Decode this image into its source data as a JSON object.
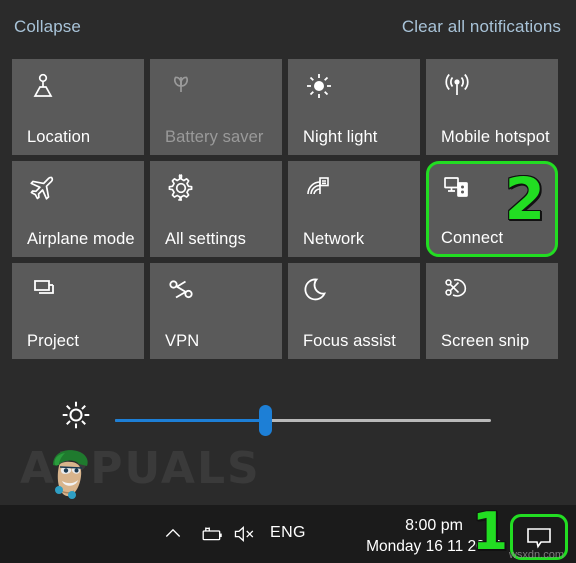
{
  "action_center": {
    "collapse_label": "Collapse",
    "clear_all_label": "Clear all notifications",
    "tiles": [
      {
        "label": "Location",
        "icon": "location-icon",
        "state": "on"
      },
      {
        "label": "Battery saver",
        "icon": "battery-saver-icon",
        "state": "disabled"
      },
      {
        "label": "Night light",
        "icon": "night-light-icon",
        "state": "on"
      },
      {
        "label": "Mobile hotspot",
        "icon": "mobile-hotspot-icon",
        "state": "on"
      },
      {
        "label": "Airplane mode",
        "icon": "airplane-icon",
        "state": "on"
      },
      {
        "label": "All settings",
        "icon": "gear-icon",
        "state": "on"
      },
      {
        "label": "Network",
        "icon": "network-icon",
        "state": "on"
      },
      {
        "label": "Connect",
        "icon": "connect-icon",
        "state": "highlighted"
      },
      {
        "label": "Project",
        "icon": "project-icon",
        "state": "on"
      },
      {
        "label": "VPN",
        "icon": "vpn-icon",
        "state": "on"
      },
      {
        "label": "Focus assist",
        "icon": "moon-icon",
        "state": "on"
      },
      {
        "label": "Screen snip",
        "icon": "screen-snip-icon",
        "state": "on"
      }
    ],
    "brightness": {
      "icon": "brightness-icon",
      "value_percent": 40
    }
  },
  "annotations": {
    "step_one": "1",
    "step_two": "2",
    "highlight_color": "#22dd22"
  },
  "watermark": {
    "brand_text": "APPUALS",
    "site_text": "wsxdn.com"
  },
  "taskbar": {
    "chevron_icon": "chevron-up-icon",
    "battery_icon": "battery-charging-icon",
    "volume_icon": "volume-muted-icon",
    "language": "ENG",
    "time": "8:00 pm",
    "date": "Monday 16 11 2020",
    "notifications_icon": "notification-bubble-icon"
  }
}
